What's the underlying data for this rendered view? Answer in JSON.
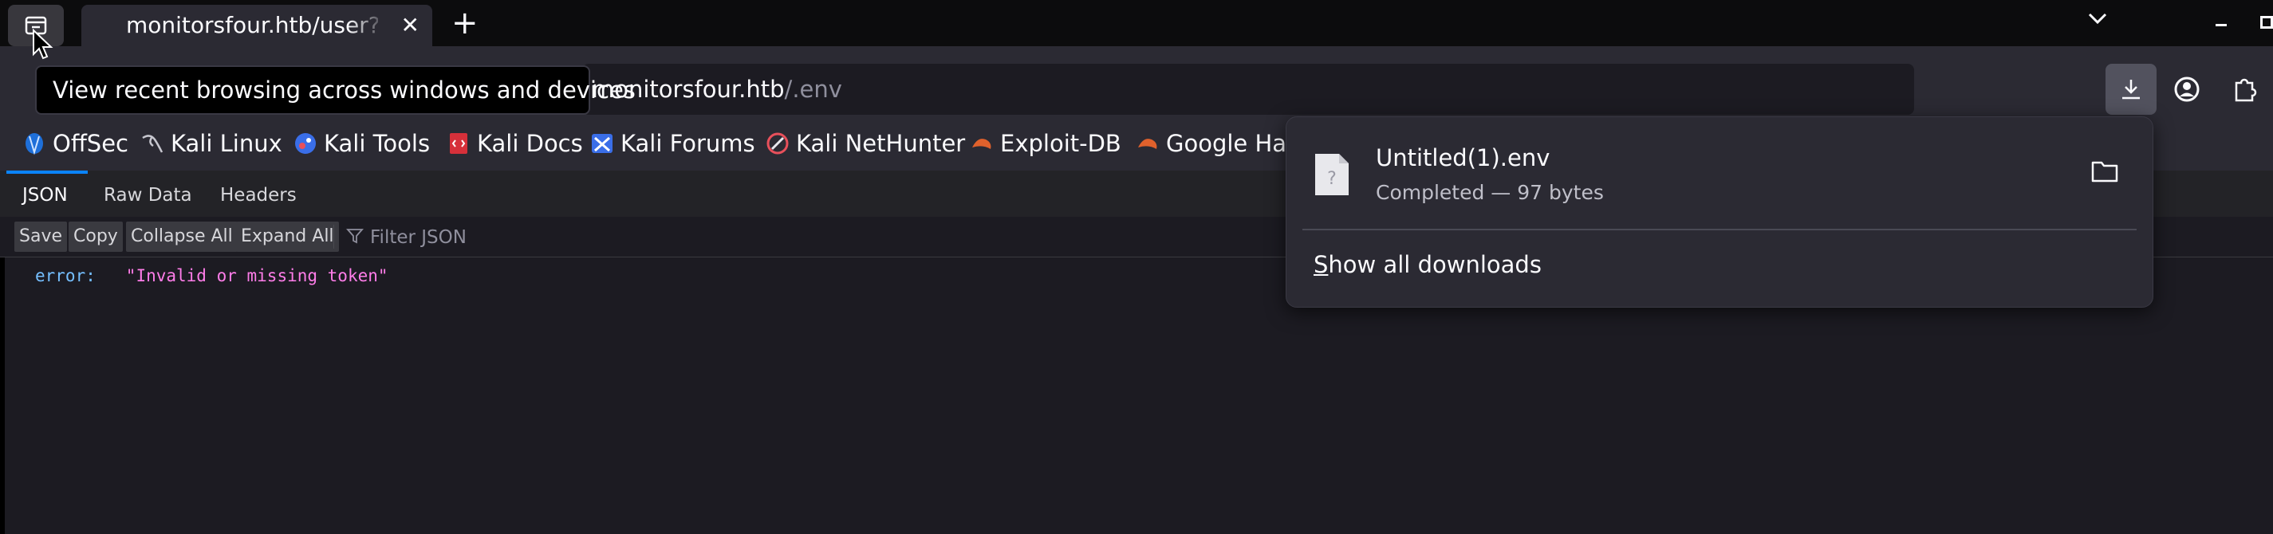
{
  "browser": {
    "active_tab_title": "monitorsfour.htb/user?token=",
    "url_host": "monitorsfour.htb",
    "url_path": "/.env",
    "tooltip": "View recent browsing across windows and devices"
  },
  "bookmarks": [
    {
      "label": "OffSec",
      "icon": "offsec-icon"
    },
    {
      "label": "Kali Linux",
      "icon": "kali-dragon-icon"
    },
    {
      "label": "Kali Tools",
      "icon": "kali-tools-icon"
    },
    {
      "label": "Kali Docs",
      "icon": "kali-docs-icon"
    },
    {
      "label": "Kali Forums",
      "icon": "kali-forums-icon"
    },
    {
      "label": "Kali NetHunter",
      "icon": "nethunter-icon"
    },
    {
      "label": "Exploit-DB",
      "icon": "exploit-db-icon"
    },
    {
      "label": "Google Hacking DB",
      "icon": "ghdb-icon"
    }
  ],
  "viewer": {
    "tabs": [
      "JSON",
      "Raw Data",
      "Headers"
    ],
    "toolbar": {
      "save": "Save",
      "copy": "Copy",
      "collapse_all": "Collapse All",
      "expand_all": "Expand All",
      "filter_placeholder": "Filter JSON"
    },
    "json": {
      "key": "error:",
      "value": "\"Invalid or missing token\""
    }
  },
  "downloads": {
    "filename": "Untitled(1).env",
    "status": "Completed — 97 bytes",
    "show_all_first": "S",
    "show_all_rest": "how all downloads"
  },
  "colors": {
    "accent": "#0a84ff",
    "json_key": "#75bfff",
    "json_string": "#ff7de9"
  }
}
